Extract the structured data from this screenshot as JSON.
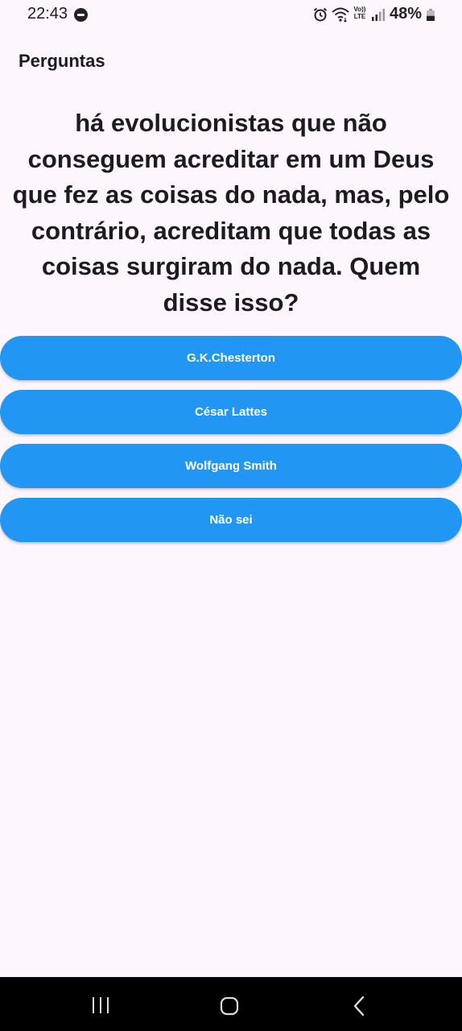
{
  "status_bar": {
    "time": "22:43",
    "volte_label": "Vo)) LTE",
    "battery_percent": "48%",
    "battery_level": 0.48,
    "icons": [
      "do-not-disturb-icon",
      "alarm-icon",
      "wifi-icon",
      "volte-icon",
      "signal-icon",
      "battery-icon"
    ]
  },
  "app_bar": {
    "title": "Perguntas"
  },
  "question": {
    "text": "há evolucionistas que não conseguem acreditar em um Deus que fez as coisas do nada, mas, pelo contrário, acreditam que todas as coisas surgiram do nada.  Quem disse isso?"
  },
  "answers": [
    {
      "label": "G.K.Chesterton"
    },
    {
      "label": "César Lattes"
    },
    {
      "label": "Wolfgang Smith"
    },
    {
      "label": "Não sei"
    }
  ],
  "nav_bar": {
    "icons": [
      "recent-apps-icon",
      "home-icon",
      "back-icon"
    ]
  },
  "colors": {
    "background": "#fdf7fd",
    "button": "#2196f3",
    "button_text": "#ffffff",
    "nav_bar": "#000000"
  }
}
